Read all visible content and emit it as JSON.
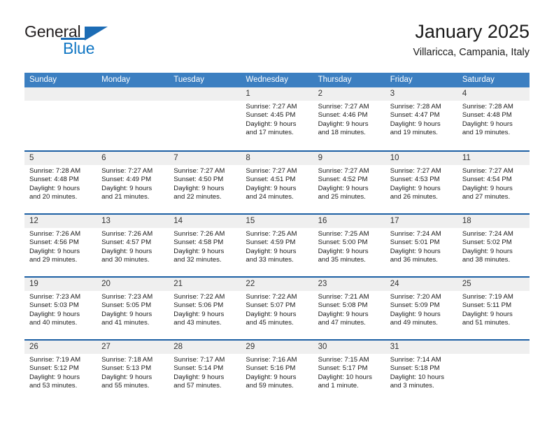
{
  "brand": {
    "word_one": "General",
    "word_two": "Blue",
    "accent_color": "#1c6cb5"
  },
  "header": {
    "title": "January 2025",
    "subtitle": "Villaricca, Campania, Italy",
    "header_bg": "#3c7fc1",
    "row_divider": "#1c5fa4",
    "date_band_bg": "#efefef"
  },
  "weekdays": [
    "Sunday",
    "Monday",
    "Tuesday",
    "Wednesday",
    "Thursday",
    "Friday",
    "Saturday"
  ],
  "weeks": [
    [
      {
        "day": "",
        "lines": []
      },
      {
        "day": "",
        "lines": []
      },
      {
        "day": "",
        "lines": []
      },
      {
        "day": "1",
        "lines": [
          "Sunrise: 7:27 AM",
          "Sunset: 4:45 PM",
          "Daylight: 9 hours",
          "and 17 minutes."
        ]
      },
      {
        "day": "2",
        "lines": [
          "Sunrise: 7:27 AM",
          "Sunset: 4:46 PM",
          "Daylight: 9 hours",
          "and 18 minutes."
        ]
      },
      {
        "day": "3",
        "lines": [
          "Sunrise: 7:28 AM",
          "Sunset: 4:47 PM",
          "Daylight: 9 hours",
          "and 19 minutes."
        ]
      },
      {
        "day": "4",
        "lines": [
          "Sunrise: 7:28 AM",
          "Sunset: 4:48 PM",
          "Daylight: 9 hours",
          "and 19 minutes."
        ]
      }
    ],
    [
      {
        "day": "5",
        "lines": [
          "Sunrise: 7:28 AM",
          "Sunset: 4:48 PM",
          "Daylight: 9 hours",
          "and 20 minutes."
        ]
      },
      {
        "day": "6",
        "lines": [
          "Sunrise: 7:27 AM",
          "Sunset: 4:49 PM",
          "Daylight: 9 hours",
          "and 21 minutes."
        ]
      },
      {
        "day": "7",
        "lines": [
          "Sunrise: 7:27 AM",
          "Sunset: 4:50 PM",
          "Daylight: 9 hours",
          "and 22 minutes."
        ]
      },
      {
        "day": "8",
        "lines": [
          "Sunrise: 7:27 AM",
          "Sunset: 4:51 PM",
          "Daylight: 9 hours",
          "and 24 minutes."
        ]
      },
      {
        "day": "9",
        "lines": [
          "Sunrise: 7:27 AM",
          "Sunset: 4:52 PM",
          "Daylight: 9 hours",
          "and 25 minutes."
        ]
      },
      {
        "day": "10",
        "lines": [
          "Sunrise: 7:27 AM",
          "Sunset: 4:53 PM",
          "Daylight: 9 hours",
          "and 26 minutes."
        ]
      },
      {
        "day": "11",
        "lines": [
          "Sunrise: 7:27 AM",
          "Sunset: 4:54 PM",
          "Daylight: 9 hours",
          "and 27 minutes."
        ]
      }
    ],
    [
      {
        "day": "12",
        "lines": [
          "Sunrise: 7:26 AM",
          "Sunset: 4:56 PM",
          "Daylight: 9 hours",
          "and 29 minutes."
        ]
      },
      {
        "day": "13",
        "lines": [
          "Sunrise: 7:26 AM",
          "Sunset: 4:57 PM",
          "Daylight: 9 hours",
          "and 30 minutes."
        ]
      },
      {
        "day": "14",
        "lines": [
          "Sunrise: 7:26 AM",
          "Sunset: 4:58 PM",
          "Daylight: 9 hours",
          "and 32 minutes."
        ]
      },
      {
        "day": "15",
        "lines": [
          "Sunrise: 7:25 AM",
          "Sunset: 4:59 PM",
          "Daylight: 9 hours",
          "and 33 minutes."
        ]
      },
      {
        "day": "16",
        "lines": [
          "Sunrise: 7:25 AM",
          "Sunset: 5:00 PM",
          "Daylight: 9 hours",
          "and 35 minutes."
        ]
      },
      {
        "day": "17",
        "lines": [
          "Sunrise: 7:24 AM",
          "Sunset: 5:01 PM",
          "Daylight: 9 hours",
          "and 36 minutes."
        ]
      },
      {
        "day": "18",
        "lines": [
          "Sunrise: 7:24 AM",
          "Sunset: 5:02 PM",
          "Daylight: 9 hours",
          "and 38 minutes."
        ]
      }
    ],
    [
      {
        "day": "19",
        "lines": [
          "Sunrise: 7:23 AM",
          "Sunset: 5:03 PM",
          "Daylight: 9 hours",
          "and 40 minutes."
        ]
      },
      {
        "day": "20",
        "lines": [
          "Sunrise: 7:23 AM",
          "Sunset: 5:05 PM",
          "Daylight: 9 hours",
          "and 41 minutes."
        ]
      },
      {
        "day": "21",
        "lines": [
          "Sunrise: 7:22 AM",
          "Sunset: 5:06 PM",
          "Daylight: 9 hours",
          "and 43 minutes."
        ]
      },
      {
        "day": "22",
        "lines": [
          "Sunrise: 7:22 AM",
          "Sunset: 5:07 PM",
          "Daylight: 9 hours",
          "and 45 minutes."
        ]
      },
      {
        "day": "23",
        "lines": [
          "Sunrise: 7:21 AM",
          "Sunset: 5:08 PM",
          "Daylight: 9 hours",
          "and 47 minutes."
        ]
      },
      {
        "day": "24",
        "lines": [
          "Sunrise: 7:20 AM",
          "Sunset: 5:09 PM",
          "Daylight: 9 hours",
          "and 49 minutes."
        ]
      },
      {
        "day": "25",
        "lines": [
          "Sunrise: 7:19 AM",
          "Sunset: 5:11 PM",
          "Daylight: 9 hours",
          "and 51 minutes."
        ]
      }
    ],
    [
      {
        "day": "26",
        "lines": [
          "Sunrise: 7:19 AM",
          "Sunset: 5:12 PM",
          "Daylight: 9 hours",
          "and 53 minutes."
        ]
      },
      {
        "day": "27",
        "lines": [
          "Sunrise: 7:18 AM",
          "Sunset: 5:13 PM",
          "Daylight: 9 hours",
          "and 55 minutes."
        ]
      },
      {
        "day": "28",
        "lines": [
          "Sunrise: 7:17 AM",
          "Sunset: 5:14 PM",
          "Daylight: 9 hours",
          "and 57 minutes."
        ]
      },
      {
        "day": "29",
        "lines": [
          "Sunrise: 7:16 AM",
          "Sunset: 5:16 PM",
          "Daylight: 9 hours",
          "and 59 minutes."
        ]
      },
      {
        "day": "30",
        "lines": [
          "Sunrise: 7:15 AM",
          "Sunset: 5:17 PM",
          "Daylight: 10 hours",
          "and 1 minute."
        ]
      },
      {
        "day": "31",
        "lines": [
          "Sunrise: 7:14 AM",
          "Sunset: 5:18 PM",
          "Daylight: 10 hours",
          "and 3 minutes."
        ]
      },
      {
        "day": "",
        "lines": []
      }
    ]
  ]
}
